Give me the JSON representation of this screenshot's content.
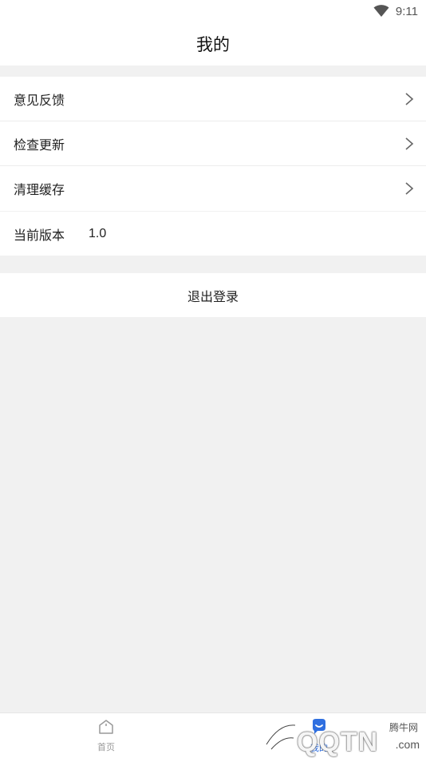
{
  "status_bar": {
    "time": "9:11",
    "wifi_icon": "wifi-icon"
  },
  "header": {
    "title": "我的"
  },
  "menu": {
    "items": [
      {
        "label": "意见反馈",
        "icon": "chevron-right-icon"
      },
      {
        "label": "检查更新",
        "icon": "chevron-right-icon"
      },
      {
        "label": "清理缓存",
        "icon": "chevron-right-icon"
      }
    ]
  },
  "version": {
    "label": "当前版本",
    "value": "1.0"
  },
  "logout": {
    "label": "退出登录"
  },
  "tabbar": {
    "home": {
      "label": "首页",
      "icon": "home-icon",
      "color": "#999999"
    },
    "mine": {
      "label": "我的",
      "icon": "person-icon",
      "color": "#2f6fe0"
    }
  },
  "watermark": {
    "top": "腾牛网",
    "main": "QQTN",
    "suffix": ".com"
  }
}
